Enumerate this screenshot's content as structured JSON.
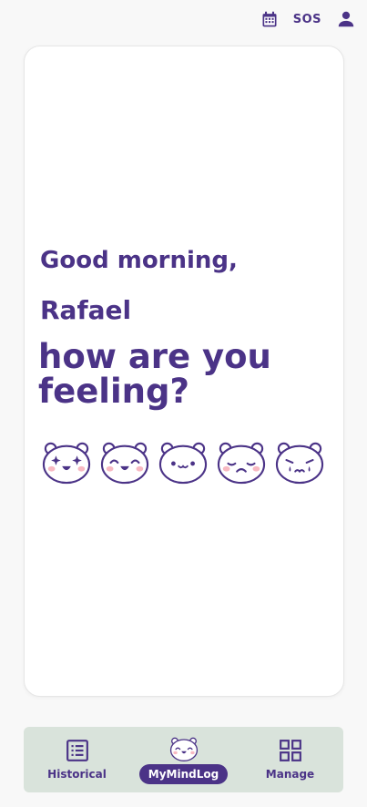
{
  "header": {
    "calendar_icon": "calendar-icon",
    "sos_label": "SOS",
    "profile_icon": "person-icon"
  },
  "greeting": {
    "line1": "Good morning,",
    "name": "Rafael",
    "question": "how are you feeling?"
  },
  "moods": [
    {
      "icon": "mood-ecstatic-icon"
    },
    {
      "icon": "mood-happy-icon"
    },
    {
      "icon": "mood-neutral-icon"
    },
    {
      "icon": "mood-sad-icon"
    },
    {
      "icon": "mood-crying-icon"
    }
  ],
  "nav": {
    "historical": "Historical",
    "mymindlog": "MyMindLog",
    "manage": "Manage"
  },
  "colors": {
    "accent": "#4b3387",
    "nav_background": "#d9e3db",
    "blush": "#f8b9c2"
  }
}
